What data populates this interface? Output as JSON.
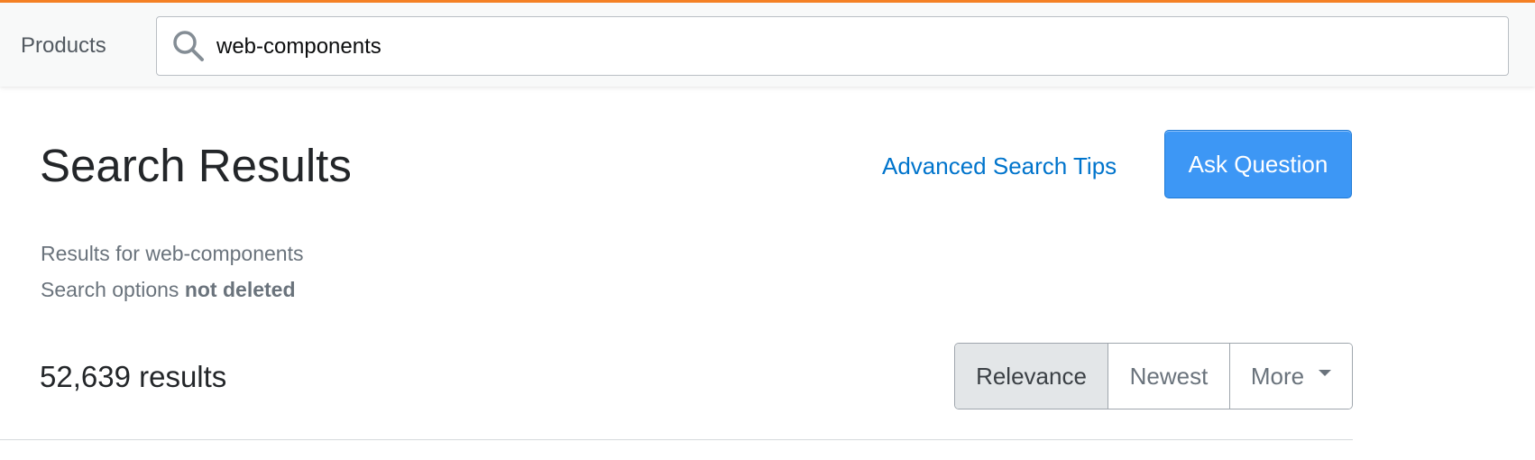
{
  "header": {
    "products_label": "Products",
    "search": {
      "value": "web-components",
      "icon": "search-icon"
    },
    "accent_color": "#f48024"
  },
  "main": {
    "title": "Search Results",
    "advanced_tips_label": "Advanced Search Tips",
    "ask_question_label": "Ask Question",
    "results_for_prefix": "Results for",
    "results_for_query": "web-components",
    "search_options_prefix": "Search options",
    "search_options_value": "not deleted",
    "results_count": "52,639 results"
  },
  "sort": {
    "options": [
      {
        "label": "Relevance",
        "active": true
      },
      {
        "label": "Newest",
        "active": false
      },
      {
        "label": "More",
        "active": false
      }
    ]
  },
  "colors": {
    "link": "#0074cc",
    "primary_button": "#3d97f5",
    "active_sort_bg": "#e3e6e8"
  }
}
